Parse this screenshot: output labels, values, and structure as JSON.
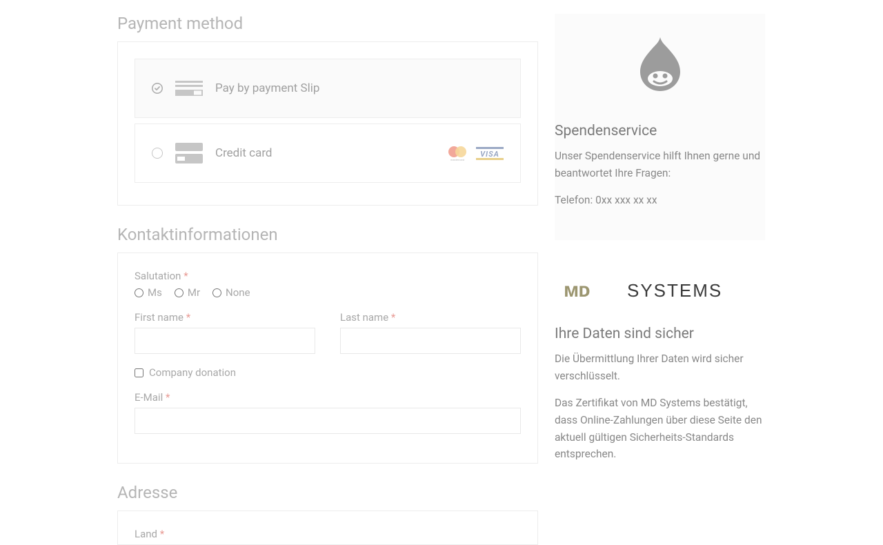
{
  "payment": {
    "heading": "Payment method",
    "options": {
      "slip": "Pay by payment Slip",
      "credit": "Credit card"
    }
  },
  "contact": {
    "heading": "Kontaktinformationen",
    "salutation": {
      "label": "Salutation",
      "ms": "Ms",
      "mr": "Mr",
      "none": "None"
    },
    "first_name": "First name",
    "last_name": "Last name",
    "company": "Company donation",
    "email": "E-Mail"
  },
  "address": {
    "heading": "Adresse",
    "country": "Land"
  },
  "service": {
    "heading": "Spendenservice",
    "body": "Unser Spendenservice hilft Ihnen gerne und beantwortet Ihre Fragen:",
    "phone": "Telefon: 0xx xxx xx xx"
  },
  "secure": {
    "heading": "Ihre Daten sind sicher",
    "p1": "Die Übermittlung Ihrer Daten wird sicher verschlüsselt.",
    "p2": "Das Zertifikat von MD Systems bestätigt, dass Online-Zahlungen über diese Seite den aktuell gültigen Sicherheits-Standards entsprechen."
  }
}
